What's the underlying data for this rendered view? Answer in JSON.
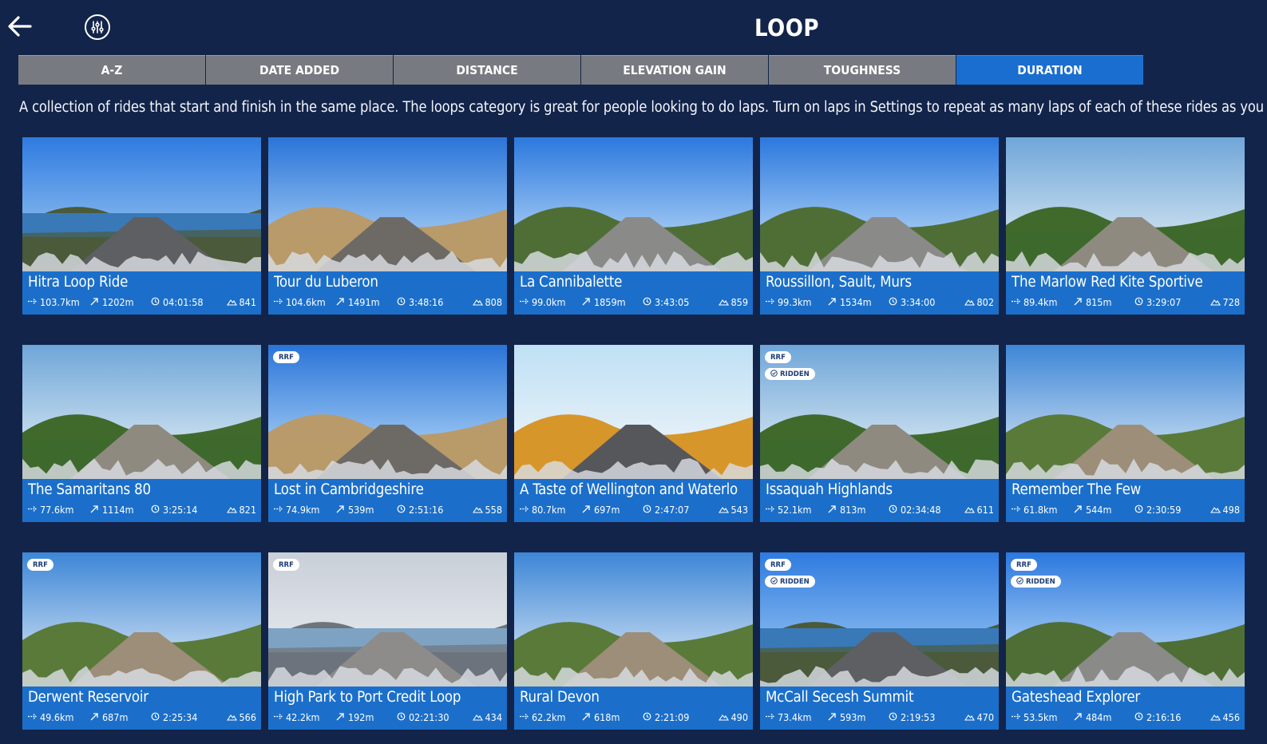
{
  "header": {
    "title": "LOOP",
    "back_icon": "arrow-left-icon",
    "filter_icon": "sliders-icon"
  },
  "sort_tabs": [
    {
      "label": "A-Z",
      "active": false
    },
    {
      "label": "DATE ADDED",
      "active": false
    },
    {
      "label": "DISTANCE",
      "active": false
    },
    {
      "label": "ELEVATION GAIN",
      "active": false
    },
    {
      "label": "TOUGHNESS",
      "active": false
    },
    {
      "label": "DURATION",
      "active": true
    }
  ],
  "description": "A collection of rides that start and finish in the same place. The loops category is great for people looking to do laps. Turn on laps in Settings to repeat as many laps of each of these rides as you want.",
  "badges": {
    "rrf": "RRF",
    "ridden": "RIDDEN"
  },
  "colors": {
    "background": "#13244a",
    "accent": "#1a6ed0",
    "card": "#1b6fca",
    "tab_inactive": "#777a80"
  },
  "rides": [
    {
      "title": "Hitra Loop Ride",
      "distance": "103.7km",
      "elevation": "1202m",
      "duration": "04:01:58",
      "toughness": "841",
      "rrf": false,
      "ridden": false,
      "scene": "lake"
    },
    {
      "title": "Tour du Luberon",
      "distance": "104.6km",
      "elevation": "1491m",
      "duration": "3:48:16",
      "toughness": "808",
      "rrf": false,
      "ridden": false,
      "scene": "village"
    },
    {
      "title": "La Cannibalette",
      "distance": "99.0km",
      "elevation": "1859m",
      "duration": "3:43:05",
      "toughness": "859",
      "rrf": false,
      "ridden": false,
      "scene": "hills"
    },
    {
      "title": "Roussillon, Sault, Murs",
      "distance": "99.3km",
      "elevation": "1534m",
      "duration": "3:34:00",
      "toughness": "802",
      "rrf": false,
      "ridden": false,
      "scene": "hills"
    },
    {
      "title": "The Marlow Red Kite Sportive",
      "distance": "89.4km",
      "elevation": "815m",
      "duration": "3:29:07",
      "toughness": "728",
      "rrf": false,
      "ridden": false,
      "scene": "lane"
    },
    {
      "title": "The Samaritans 80",
      "distance": "77.6km",
      "elevation": "1114m",
      "duration": "3:25:14",
      "toughness": "821",
      "rrf": false,
      "ridden": false,
      "scene": "lane"
    },
    {
      "title": "Lost in Cambridgeshire",
      "distance": "74.9km",
      "elevation": "539m",
      "duration": "2:51:16",
      "toughness": "558",
      "rrf": true,
      "ridden": false,
      "scene": "village"
    },
    {
      "title": "A Taste of Wellington and Waterlo",
      "distance": "80.7km",
      "elevation": "697m",
      "duration": "2:47:07",
      "toughness": "543",
      "rrf": false,
      "ridden": false,
      "scene": "autumn"
    },
    {
      "title": "Issaquah Highlands",
      "distance": "52.1km",
      "elevation": "813m",
      "duration": "02:34:48",
      "toughness": "611",
      "rrf": true,
      "ridden": true,
      "scene": "lane"
    },
    {
      "title": "Remember The Few",
      "distance": "61.8km",
      "elevation": "544m",
      "duration": "2:30:59",
      "toughness": "498",
      "rrf": false,
      "ridden": false,
      "scene": "fields"
    },
    {
      "title": "Derwent Reservoir",
      "distance": "49.6km",
      "elevation": "687m",
      "duration": "2:25:34",
      "toughness": "566",
      "rrf": true,
      "ridden": false,
      "scene": "fields"
    },
    {
      "title": "High Park to Port Credit Loop",
      "distance": "42.2km",
      "elevation": "192m",
      "duration": "02:21:30",
      "toughness": "434",
      "rrf": true,
      "ridden": false,
      "scene": "city"
    },
    {
      "title": "Rural Devon",
      "distance": "62.2km",
      "elevation": "618m",
      "duration": "2:21:09",
      "toughness": "490",
      "rrf": false,
      "ridden": false,
      "scene": "fields"
    },
    {
      "title": "McCall Secesh Summit",
      "distance": "73.4km",
      "elevation": "593m",
      "duration": "2:19:53",
      "toughness": "470",
      "rrf": true,
      "ridden": true,
      "scene": "lake"
    },
    {
      "title": "Gateshead Explorer",
      "distance": "53.5km",
      "elevation": "484m",
      "duration": "2:16:16",
      "toughness": "456",
      "rrf": true,
      "ridden": true,
      "scene": "hills"
    }
  ]
}
